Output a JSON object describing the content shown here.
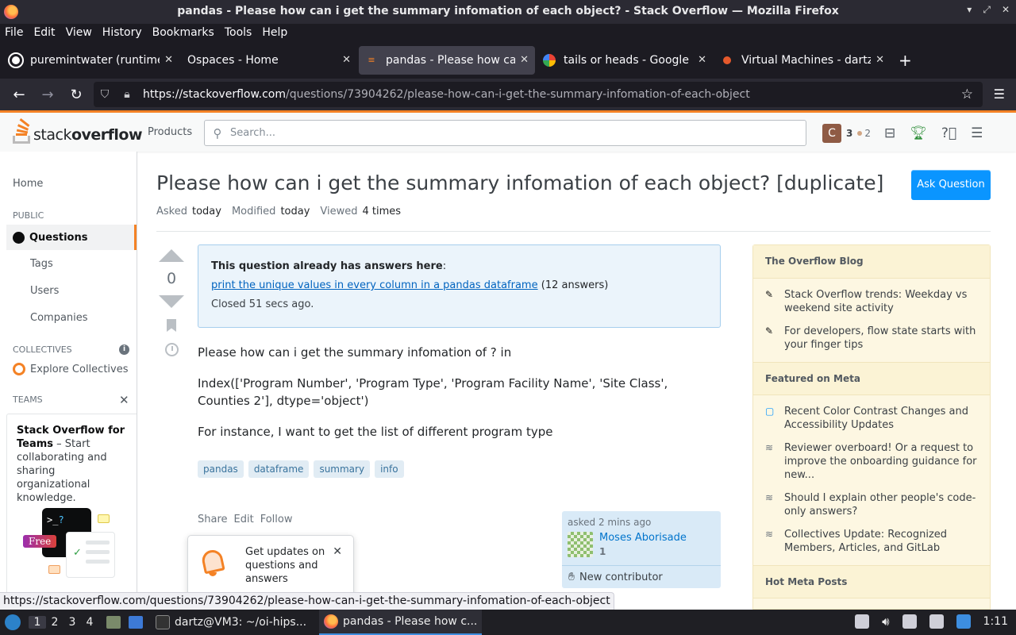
{
  "browser": {
    "window_title": "pandas - Please how can i get the summary infomation of each object? - Stack Overflow — Mozilla Firefox",
    "menu": [
      "File",
      "Edit",
      "View",
      "History",
      "Bookmarks",
      "Tools",
      "Help"
    ],
    "tabs": [
      {
        "label": "puremintwater (runtime)",
        "close": "✕"
      },
      {
        "label": "Ospaces - Home",
        "close": "✕"
      },
      {
        "label": "pandas - Please how can i get",
        "close": "✕"
      },
      {
        "label": "tails or heads - Google Search",
        "close": "✕"
      },
      {
        "label": "Virtual Machines - dartz@",
        "close": "✕"
      }
    ],
    "new_tab": "+",
    "url_host": "https://stackoverflow.com",
    "url_path": "/questions/73904262/please-how-can-i-get-the-summary-infomation-of-each-object",
    "status_url": "https://stackoverflow.com/questions/73904262/please-how-can-i-get-the-summary-infomation-of-each-object"
  },
  "so_header": {
    "logo_light": "stack",
    "logo_bold": "overflow",
    "products": "Products",
    "search_placeholder": "Search...",
    "avatar_letter": "C",
    "reputation": "3",
    "bronze_badges": "2"
  },
  "leftnav": {
    "home": "Home",
    "public": "PUBLIC",
    "questions": "Questions",
    "tags": "Tags",
    "users": "Users",
    "companies": "Companies",
    "collectives": "COLLECTIVES",
    "explore": "Explore Collectives",
    "teams": "TEAMS",
    "teams_bold": "Stack Overflow for Teams",
    "teams_text": " – Start collaborating and sharing organizational knowledge.",
    "free_badge": "Free",
    "term_prompt": ">_",
    "term_q": "?"
  },
  "question": {
    "title": "Please how can i get the summary infomation of each object? [duplicate]",
    "ask_button": "Ask Question",
    "asked_label": "Asked",
    "asked_value": "today",
    "modified_label": "Modified",
    "modified_value": "today",
    "viewed_label": "Viewed",
    "viewed_value": "4 times",
    "score": "0",
    "duplicate_heading": "This question already has answers here",
    "duplicate_colon": ":",
    "duplicate_link": "print the unique values in every column in a pandas dataframe",
    "duplicate_count": " (12 answers)",
    "closed_text": "Closed 51 secs ago.",
    "body": [
      "Please how can i get the summary infomation of ? in",
      "Index(['Program Number', 'Program Type', 'Program Facility Name', 'Site Class', Counties 2'], dtype='object')",
      "For instance, I want to get the list of different program type"
    ],
    "tags": [
      "pandas",
      "dataframe",
      "summary",
      "info"
    ],
    "actions": [
      "Share",
      "Edit",
      "Follow"
    ],
    "popup_text": "Get updates on questions and answers",
    "asked_ago": "asked 2 mins ago",
    "owner_name": "Moses Aborisade",
    "owner_rep": "1",
    "new_contributor": "New contributor"
  },
  "sidebar": {
    "blog_heading": "The Overflow Blog",
    "blog_items": [
      "Stack Overflow trends: Weekday vs weekend site activity",
      "For developers, flow state starts with your finger tips"
    ],
    "meta_heading": "Featured on Meta",
    "meta_items": [
      "Recent Color Contrast Changes and Accessibility Updates",
      "Reviewer overboard! Or a request to improve the onboarding guidance for new...",
      "Should I explain other people's code-only answers?",
      "Collectives Update: Recognized Members, Articles, and GitLab"
    ],
    "hot_heading": "Hot Meta Posts"
  },
  "taskbar": {
    "workspaces": [
      "1",
      "2",
      "3",
      "4"
    ],
    "terminal_task": "dartz@VM3: ~/oi-hips...",
    "firefox_task": "pandas - Please how c...",
    "clock": "1:11"
  },
  "colors": {
    "so_orange": "#f48225",
    "so_blue_button": "#0a95ff",
    "firefox_chrome": "#1c1b22"
  }
}
